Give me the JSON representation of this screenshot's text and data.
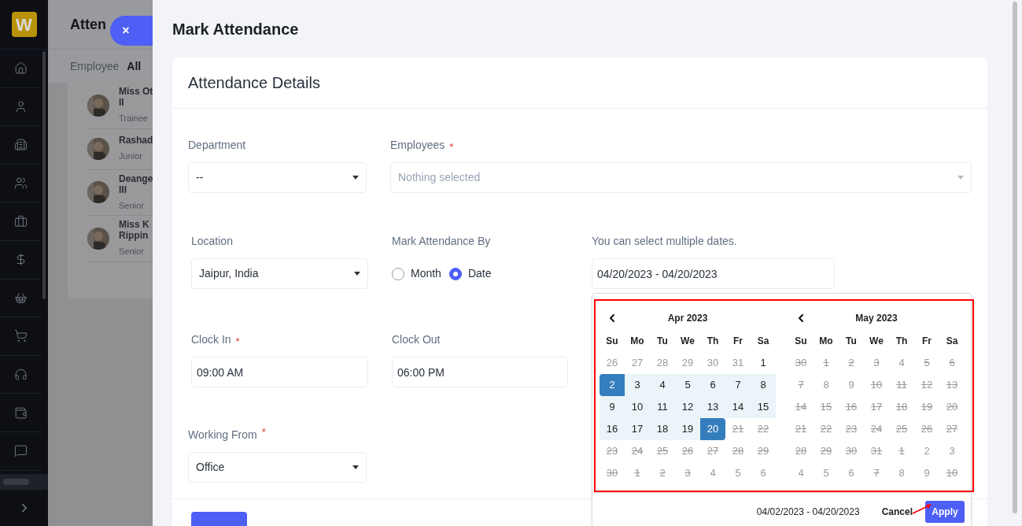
{
  "sidebar": {
    "logo": "W"
  },
  "background_page": {
    "title": "Atten",
    "filter_label": "Employee",
    "filter_value": "All",
    "employees": [
      {
        "name": [
          "Miss Ot",
          "II"
        ],
        "role": "Trainee"
      },
      {
        "name": [
          "Rashad"
        ],
        "role": "Junior"
      },
      {
        "name": [
          "Deange",
          "III"
        ],
        "role": "Senior"
      },
      {
        "name": [
          "Miss K",
          "Rippin"
        ],
        "role": "Senior"
      }
    ]
  },
  "close_button": "×",
  "modal": {
    "title": "Mark Attendance",
    "card_title": "Attendance Details",
    "department": {
      "label": "Department",
      "value": "--"
    },
    "required_mark": "*",
    "employees": {
      "label": "Employees",
      "required": true,
      "placeholder": "Nothing selected"
    },
    "location": {
      "label": "Location",
      "value": "Jaipur, India"
    },
    "mark_by": {
      "label": "Mark Attendance By",
      "options": [
        {
          "label": "Month",
          "selected": false
        },
        {
          "label": "Date",
          "selected": true
        }
      ]
    },
    "dates": {
      "label": "You can select multiple dates.",
      "value": "04/20/2023 - 04/20/2023"
    },
    "clock_in": {
      "label": "Clock In",
      "required": true,
      "value": "09:00 AM"
    },
    "clock_out": {
      "label": "Clock Out",
      "value": "06:00 PM"
    },
    "working_from": {
      "label": "Working From",
      "required": true,
      "value": "Office"
    }
  },
  "date_picker": {
    "months": [
      {
        "title": "Apr 2023",
        "weekdays": [
          "Su",
          "Mo",
          "Tu",
          "We",
          "Th",
          "Fr",
          "Sa"
        ],
        "weeks": [
          [
            {
              "d": "26",
              "kind": "muted"
            },
            {
              "d": "27",
              "kind": "muted"
            },
            {
              "d": "28",
              "kind": "muted"
            },
            {
              "d": "29",
              "kind": "muted"
            },
            {
              "d": "30",
              "kind": "muted"
            },
            {
              "d": "31",
              "kind": "muted"
            },
            {
              "d": "1",
              "kind": "on"
            }
          ],
          [
            {
              "d": "2",
              "kind": "start"
            },
            {
              "d": "3",
              "kind": "range"
            },
            {
              "d": "4",
              "kind": "range"
            },
            {
              "d": "5",
              "kind": "range"
            },
            {
              "d": "6",
              "kind": "range"
            },
            {
              "d": "7",
              "kind": "range"
            },
            {
              "d": "8",
              "kind": "range"
            }
          ],
          [
            {
              "d": "9",
              "kind": "range"
            },
            {
              "d": "10",
              "kind": "range"
            },
            {
              "d": "11",
              "kind": "range"
            },
            {
              "d": "12",
              "kind": "range"
            },
            {
              "d": "13",
              "kind": "range"
            },
            {
              "d": "14",
              "kind": "range"
            },
            {
              "d": "15",
              "kind": "range"
            }
          ],
          [
            {
              "d": "16",
              "kind": "range"
            },
            {
              "d": "17",
              "kind": "range"
            },
            {
              "d": "18",
              "kind": "range"
            },
            {
              "d": "19",
              "kind": "range"
            },
            {
              "d": "20",
              "kind": "end"
            },
            {
              "d": "21",
              "kind": "struck"
            },
            {
              "d": "22",
              "kind": "struck"
            }
          ],
          [
            {
              "d": "23",
              "kind": "struck"
            },
            {
              "d": "24",
              "kind": "struck"
            },
            {
              "d": "25",
              "kind": "struck"
            },
            {
              "d": "26",
              "kind": "struck"
            },
            {
              "d": "27",
              "kind": "struck"
            },
            {
              "d": "28",
              "kind": "struck"
            },
            {
              "d": "29",
              "kind": "struck"
            }
          ],
          [
            {
              "d": "30",
              "kind": "struck"
            },
            {
              "d": "1",
              "kind": "struck"
            },
            {
              "d": "2",
              "kind": "struck"
            },
            {
              "d": "3",
              "kind": "struck"
            },
            {
              "d": "4",
              "kind": "muted"
            },
            {
              "d": "5",
              "kind": "muted"
            },
            {
              "d": "6",
              "kind": "muted"
            }
          ]
        ]
      },
      {
        "title": "May 2023",
        "weekdays": [
          "Su",
          "Mo",
          "Tu",
          "We",
          "Th",
          "Fr",
          "Sa"
        ],
        "weeks": [
          [
            {
              "d": "30",
              "kind": "struck"
            },
            {
              "d": "1",
              "kind": "struck"
            },
            {
              "d": "2",
              "kind": "struck"
            },
            {
              "d": "3",
              "kind": "struck"
            },
            {
              "d": "4",
              "kind": "muted"
            },
            {
              "d": "5",
              "kind": "struck"
            },
            {
              "d": "6",
              "kind": "struck"
            }
          ],
          [
            {
              "d": "7",
              "kind": "struck"
            },
            {
              "d": "8",
              "kind": "muted"
            },
            {
              "d": "9",
              "kind": "muted"
            },
            {
              "d": "10",
              "kind": "struck"
            },
            {
              "d": "11",
              "kind": "struck"
            },
            {
              "d": "12",
              "kind": "struck"
            },
            {
              "d": "13",
              "kind": "struck"
            }
          ],
          [
            {
              "d": "14",
              "kind": "struck"
            },
            {
              "d": "15",
              "kind": "struck"
            },
            {
              "d": "16",
              "kind": "struck"
            },
            {
              "d": "17",
              "kind": "struck"
            },
            {
              "d": "18",
              "kind": "struck"
            },
            {
              "d": "19",
              "kind": "struck"
            },
            {
              "d": "20",
              "kind": "struck"
            }
          ],
          [
            {
              "d": "21",
              "kind": "struck"
            },
            {
              "d": "22",
              "kind": "struck"
            },
            {
              "d": "23",
              "kind": "struck"
            },
            {
              "d": "24",
              "kind": "struck"
            },
            {
              "d": "25",
              "kind": "struck"
            },
            {
              "d": "26",
              "kind": "struck"
            },
            {
              "d": "27",
              "kind": "struck"
            }
          ],
          [
            {
              "d": "28",
              "kind": "struck"
            },
            {
              "d": "29",
              "kind": "struck"
            },
            {
              "d": "30",
              "kind": "struck"
            },
            {
              "d": "31",
              "kind": "struck"
            },
            {
              "d": "1",
              "kind": "struck"
            },
            {
              "d": "2",
              "kind": "muted"
            },
            {
              "d": "3",
              "kind": "muted"
            }
          ],
          [
            {
              "d": "4",
              "kind": "muted"
            },
            {
              "d": "5",
              "kind": "muted"
            },
            {
              "d": "6",
              "kind": "muted"
            },
            {
              "d": "7",
              "kind": "struck"
            },
            {
              "d": "8",
              "kind": "muted"
            },
            {
              "d": "9",
              "kind": "muted"
            },
            {
              "d": "10",
              "kind": "struck"
            }
          ]
        ]
      }
    ],
    "range_text": "04/02/2023 - 04/20/2023",
    "cancel": "Cancel",
    "apply": "Apply"
  }
}
